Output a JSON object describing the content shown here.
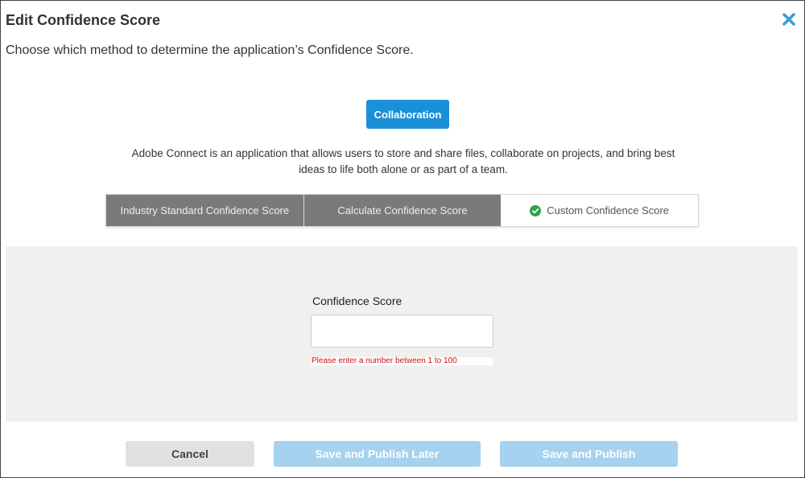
{
  "dialog": {
    "title": "Edit Confidence Score",
    "subtitle": "Choose which method to determine the application’s Confidence Score."
  },
  "application": {
    "category_badge": "Collaboration",
    "description": "Adobe Connect is an application that allows users to store and share files, collaborate on projects, and bring best ideas to life both alone or as part of a team."
  },
  "methods": {
    "tabs": [
      {
        "label": "Industry Standard Confidence Score",
        "selected": false
      },
      {
        "label": "Calculate Confidence Score",
        "selected": false
      },
      {
        "label": "Custom Confidence Score",
        "selected": true
      }
    ]
  },
  "custom_score": {
    "label": "Confidence Score",
    "value": "",
    "error": "Please enter a number between 1 to 100"
  },
  "footer": {
    "cancel_label": "Cancel",
    "save_later_label": "Save and Publish Later",
    "save_publish_label": "Save and Publish"
  },
  "icons": {
    "close": "close-icon",
    "selected_check": "check-circle-icon"
  },
  "colors": {
    "accent": "#1a90d9",
    "close_icon": "#3a9ad9",
    "tab_inactive": "#7a7a7a",
    "check_green": "#2aa54a",
    "error": "#cc1111",
    "disabled_button": "#a6d1ef"
  }
}
